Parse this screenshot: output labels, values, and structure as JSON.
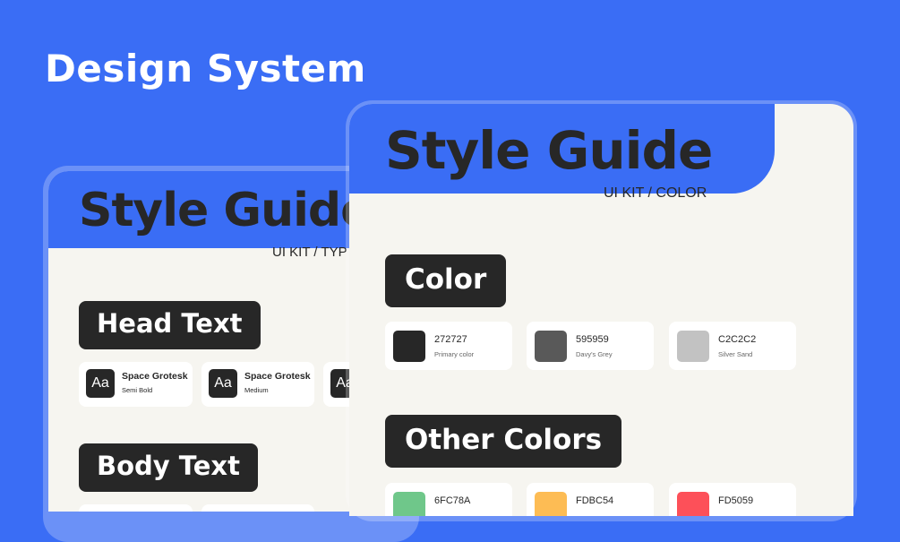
{
  "page": {
    "title": "Design System",
    "background": "#3A6DF5"
  },
  "typography_card": {
    "title": "Style Guide",
    "subtitle": "UI KIT / TYP",
    "head_section": "Head Text",
    "body_section": "Body Text",
    "fonts": [
      {
        "sample": "Aa",
        "name": "Space Grotesk",
        "weight": "Semi Bold"
      },
      {
        "sample": "Aa",
        "name": "Space Grotesk",
        "weight": "Medium"
      },
      {
        "sample": "Aa",
        "name": "",
        "weight": ""
      }
    ]
  },
  "color_card": {
    "title": "Style Guide",
    "subtitle": "UI KIT / COLOR",
    "color_section": "Color",
    "other_section": "Other Colors",
    "colors": [
      {
        "hex": "272727",
        "name": "Primary color",
        "swatch": "#272727"
      },
      {
        "hex": "595959",
        "name": "Davy's Grey",
        "swatch": "#595959"
      },
      {
        "hex": "C2C2C2",
        "name": "Silver Sand",
        "swatch": "#C2C2C2"
      }
    ],
    "other_colors": [
      {
        "hex": "6FC78A",
        "swatch": "#6FC78A"
      },
      {
        "hex": "FDBC54",
        "swatch": "#FDBC54"
      },
      {
        "hex": "FD5059",
        "swatch": "#FD5059"
      }
    ]
  }
}
